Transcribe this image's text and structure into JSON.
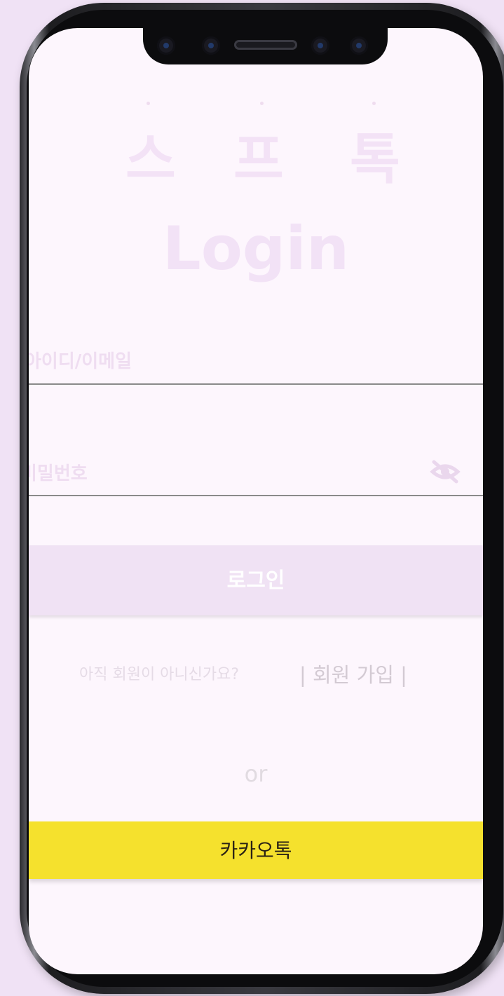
{
  "logo": {
    "chars": [
      "스",
      "프",
      "톡"
    ]
  },
  "login": {
    "title": "Login",
    "id_label": "아이디/이메일",
    "id_value": "",
    "password_label": "비밀번호",
    "password_value": "",
    "password_visibility_icon": "eye-off-icon",
    "submit_label": "로그인"
  },
  "signup": {
    "question": "아직 회원이 아니신가요?",
    "link_label": "| 회원 가입 |"
  },
  "divider": {
    "or_label": "or"
  },
  "social": {
    "kakao_label": "카카오톡"
  },
  "colors": {
    "background": "#f0e2f5",
    "screen": "#fdf6fd",
    "accent_lavender": "#f0e2f4",
    "kakao_yellow": "#f5e12d"
  }
}
